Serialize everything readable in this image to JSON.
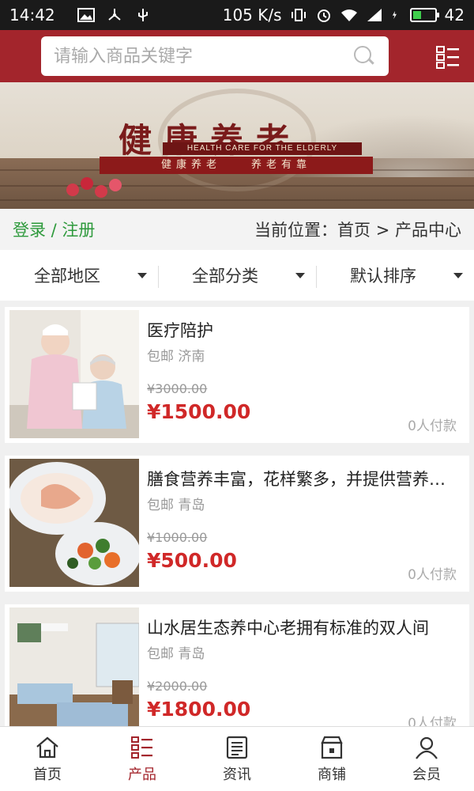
{
  "status_bar": {
    "time": "14:42",
    "net_speed": "105 K/s",
    "battery": "42",
    "battery_level": 0.42
  },
  "search": {
    "placeholder": "请输入商品关键字"
  },
  "banner": {
    "title": "健康养老",
    "subtitle_en": "HEALTH CARE FOR THE ELDERLY",
    "slogan": "健康养老　　养老有靠"
  },
  "breadcrumb": {
    "login": "登录 / 注册",
    "location": "当前位置：首页 > 产品中心"
  },
  "filters": [
    {
      "label": "全部地区"
    },
    {
      "label": "全部分类"
    },
    {
      "label": "默认排序"
    }
  ],
  "products": [
    {
      "title": "医疗陪护",
      "meta": "包邮 济南",
      "old_price": "¥3000.00",
      "price": "¥1500.00",
      "buyers": "0人付款"
    },
    {
      "title": "膳食营养丰富，花样繁多，并提供营养搭配",
      "meta": "包邮 青岛",
      "old_price": "¥1000.00",
      "price": "¥500.00",
      "buyers": "0人付款"
    },
    {
      "title": "山水居生态养中心老拥有标准的双人间",
      "meta": "包邮 青岛",
      "old_price": "¥2000.00",
      "price": "¥1800.00",
      "buyers": "0人付款"
    }
  ],
  "bottom_nav": [
    {
      "label": "首页",
      "icon": "home-icon"
    },
    {
      "label": "产品",
      "icon": "product-list-icon",
      "active": true
    },
    {
      "label": "资讯",
      "icon": "news-icon"
    },
    {
      "label": "商铺",
      "icon": "shop-icon"
    },
    {
      "label": "会员",
      "icon": "user-icon"
    }
  ],
  "colors": {
    "brand": "#a3252c",
    "price": "#d02828",
    "login": "#2e9a3c"
  }
}
